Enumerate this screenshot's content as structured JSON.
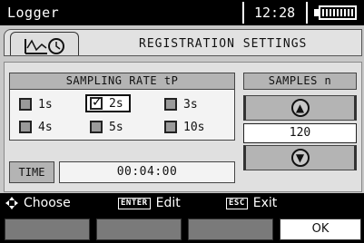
{
  "topbar": {
    "app_title": "Logger",
    "clock": "12:28",
    "battery_icon": "battery-full-icon"
  },
  "header": {
    "tab_icon": "logger-clock-icon",
    "title": "REGISTRATION SETTINGS"
  },
  "sampling_rate": {
    "title": "SAMPLING RATE tP",
    "options": [
      {
        "label": "1s",
        "checked": false
      },
      {
        "label": "2s",
        "checked": true
      },
      {
        "label": "3s",
        "checked": false
      },
      {
        "label": "4s",
        "checked": false
      },
      {
        "label": "5s",
        "checked": false
      },
      {
        "label": "10s",
        "checked": false
      }
    ],
    "time_label": "TIME",
    "time_value": "00:04:00"
  },
  "samples": {
    "title": "SAMPLES n",
    "value": "120",
    "up_icon": "arrow-up-circle-icon",
    "down_icon": "arrow-down-circle-icon"
  },
  "hints": {
    "choose": "Choose",
    "enter_key": "ENTER",
    "edit": "Edit",
    "esc_key": "ESC",
    "exit": "Exit"
  },
  "softkeys": [
    "",
    "",
    "",
    "OK"
  ]
}
